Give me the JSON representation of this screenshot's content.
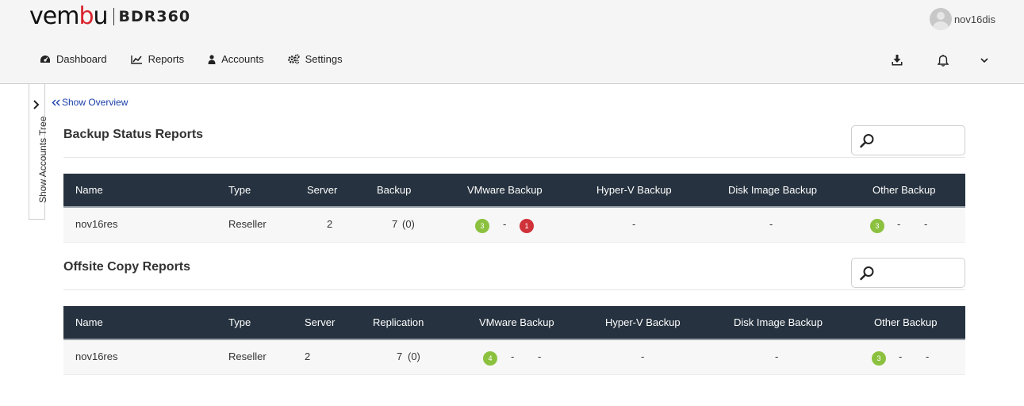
{
  "brand": {
    "logo_pre": "vem",
    "logo_accent": "b",
    "logo_post": "u",
    "product": "BDR360",
    "accent_color": "#d9232d"
  },
  "user": {
    "name": "nov16dis"
  },
  "nav": [
    {
      "label": "Dashboard",
      "icon": "dashboard-icon"
    },
    {
      "label": "Reports",
      "icon": "chart-icon"
    },
    {
      "label": "Accounts",
      "icon": "user-icon"
    },
    {
      "label": "Settings",
      "icon": "gears-icon"
    }
  ],
  "side_tab": {
    "label": "Show Accounts Tree"
  },
  "show_overview": {
    "label": "Show Overview"
  },
  "backup_status": {
    "title": "Backup Status Reports",
    "columns": [
      "Name",
      "Type",
      "Server",
      "Backup",
      "VMware Backup",
      "Hyper-V Backup",
      "Disk Image Backup",
      "Other Backup"
    ],
    "row": {
      "name": "nov16res",
      "type": "Reseller",
      "server": "2",
      "backup": "7",
      "backup_failed": "(0)",
      "vmware_success": "3",
      "vmware_mid": "-",
      "vmware_failed": "1",
      "hyperv": "-",
      "disk_image": "-",
      "other_success": "3",
      "other_mid": "-",
      "other_end": "-"
    }
  },
  "offsite_copy": {
    "title": "Offsite Copy Reports",
    "columns": [
      "Name",
      "Type",
      "Server",
      "Replication",
      "VMware Backup",
      "Hyper-V Backup",
      "Disk Image Backup",
      "Other Backup"
    ],
    "row": {
      "name": "nov16res",
      "type": "Reseller",
      "server": "2",
      "replication": "7",
      "replication_failed": "(0)",
      "vmware_success": "4",
      "vmware_mid": "-",
      "vmware_end": "-",
      "hyperv": "-",
      "disk_image": "-",
      "other_success": "3",
      "other_mid": "-",
      "other_end": "-"
    }
  },
  "colors": {
    "table_header": "#26323f",
    "success": "#8cc13f",
    "failed": "#d0323a",
    "link": "#1a3fa8"
  }
}
